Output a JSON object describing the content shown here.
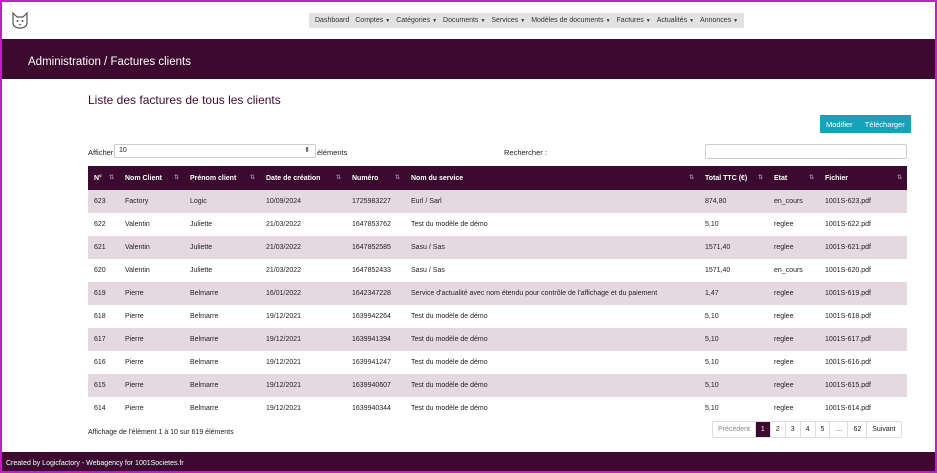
{
  "nav": {
    "items": [
      {
        "label": "Dashboard",
        "caret": false
      },
      {
        "label": "Comptes",
        "caret": true
      },
      {
        "label": "Catégories",
        "caret": true
      },
      {
        "label": "Documents",
        "caret": true
      },
      {
        "label": "Services",
        "caret": true
      },
      {
        "label": "Modèles de documents",
        "caret": true
      },
      {
        "label": "Factures",
        "caret": true
      },
      {
        "label": "Actualités",
        "caret": true
      },
      {
        "label": "Annonces",
        "caret": true
      }
    ]
  },
  "header": {
    "title": "Administration / Factures clients"
  },
  "main": {
    "heading": "Liste des factures de tous les clients",
    "buttons": {
      "modify": "Modifier",
      "download": "Télécharger"
    },
    "length_label": "Afficher",
    "length_value": "10",
    "length_suffix": "éléments",
    "search_label": "Rechercher :",
    "search_value": ""
  },
  "table": {
    "columns": [
      "N°",
      "Nom Client",
      "Prénom client",
      "Date de création",
      "Numéro",
      "Nom du service",
      "Total TTC (€)",
      "Etat",
      "Fichier"
    ],
    "rows": [
      [
        "623",
        "Factory",
        "Logic",
        "10/09/2024",
        "1725983227",
        "Eurl / Sarl",
        "874,80",
        "en_cours",
        "1001S-623.pdf"
      ],
      [
        "622",
        "Valentin",
        "Juliette",
        "21/03/2022",
        "1647853762",
        "Test du modèle de démo",
        "5,10",
        "reglee",
        "1001S-622.pdf"
      ],
      [
        "621",
        "Valentin",
        "Juliette",
        "21/03/2022",
        "1647852585",
        "Sasu / Sas",
        "1571,40",
        "reglee",
        "1001S-621.pdf"
      ],
      [
        "620",
        "Valentin",
        "Juliette",
        "21/03/2022",
        "1647852433",
        "Sasu / Sas",
        "1571,40",
        "en_cours",
        "1001S-620.pdf"
      ],
      [
        "619",
        "Pierre",
        "Belmarre",
        "16/01/2022",
        "1642347228",
        "Service d'actualité avec nom étendu pour contrôle de l'affichage et du paiement",
        "1,47",
        "reglee",
        "1001S-619.pdf"
      ],
      [
        "618",
        "Pierre",
        "Belmarre",
        "19/12/2021",
        "1639942264",
        "Test du modèle de démo",
        "5,10",
        "reglee",
        "1001S-618.pdf"
      ],
      [
        "617",
        "Pierre",
        "Belmarre",
        "19/12/2021",
        "1639941394",
        "Test du modèle de démo",
        "5,10",
        "reglee",
        "1001S-617.pdf"
      ],
      [
        "616",
        "Pierre",
        "Belmarre",
        "19/12/2021",
        "1639941247",
        "Test du modèle de démo",
        "5,10",
        "reglee",
        "1001S-616.pdf"
      ],
      [
        "615",
        "Pierre",
        "Belmarre",
        "19/12/2021",
        "1639940607",
        "Test du modèle de démo",
        "5,10",
        "reglee",
        "1001S-615.pdf"
      ],
      [
        "614",
        "Pierre",
        "Belmarre",
        "19/12/2021",
        "1639940344",
        "Test du modèle de démo",
        "5,10",
        "reglee",
        "1001S-614.pdf"
      ]
    ],
    "info": "Affichage de l'élément 1 à 10 sur 619 éléments"
  },
  "pagination": {
    "prev": "Précédent",
    "pages": [
      "1",
      "2",
      "3",
      "4",
      "5",
      "…",
      "62"
    ],
    "active": "1",
    "next": "Suivant"
  },
  "footer": {
    "text": "Created by Logicfactory - Webagency for 1001Societes.fr"
  },
  "colors": {
    "brand": "#3b0a2e",
    "accent": "#17a2b8",
    "row_stripe": "#e5d8e1"
  }
}
